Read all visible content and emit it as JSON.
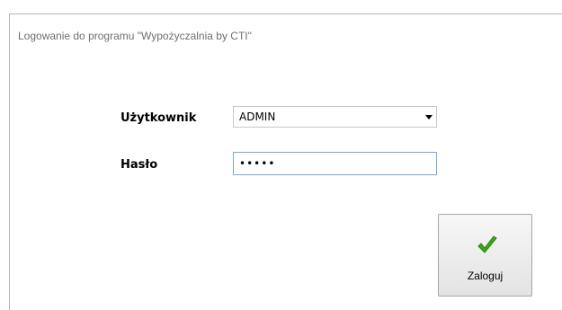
{
  "window": {
    "title": "Logowanie do programu \"Wypożyczalnia by CTI\""
  },
  "form": {
    "user_label": "Użytkownik",
    "user_value": "ADMIN",
    "password_label": "Hasło",
    "password_value": "•••••"
  },
  "actions": {
    "login_label": "Zaloguj",
    "login_icon": "check-icon",
    "login_icon_color": "#3aa815"
  }
}
